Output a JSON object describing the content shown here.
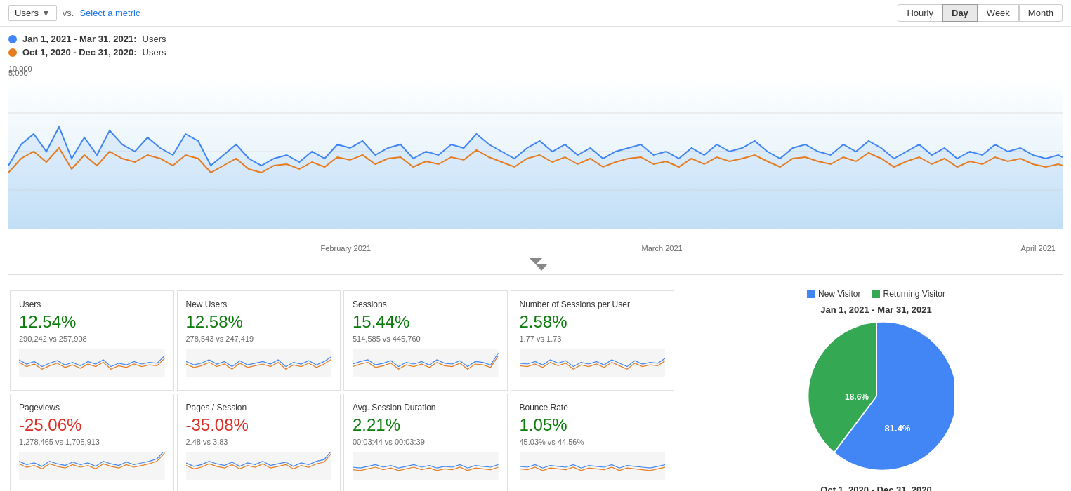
{
  "topbar": {
    "metric_selector": "Users",
    "vs_label": "vs.",
    "select_metric": "Select a metric",
    "time_buttons": [
      {
        "label": "Hourly",
        "active": false
      },
      {
        "label": "Day",
        "active": true
      },
      {
        "label": "Week",
        "active": false
      },
      {
        "label": "Month",
        "active": false
      }
    ]
  },
  "legend": {
    "range1_date": "Jan 1, 2021 - Mar 31, 2021:",
    "range1_metric": "Users",
    "range1_color": "#4285f4",
    "range2_date": "Oct 1, 2020 - Dec 31, 2020:",
    "range2_metric": "Users",
    "range2_color": "#e67c22"
  },
  "chart": {
    "y_labels": [
      "10,000",
      "5,000"
    ],
    "x_labels": [
      "February 2021",
      "March 2021",
      "April 2021"
    ]
  },
  "metrics": [
    {
      "title": "Users",
      "value": "12.54%",
      "type": "positive",
      "compare": "290,242 vs 257,908"
    },
    {
      "title": "New Users",
      "value": "12.58%",
      "type": "positive",
      "compare": "278,543 vs 247,419"
    },
    {
      "title": "Sessions",
      "value": "15.44%",
      "type": "positive",
      "compare": "514,585 vs 445,760"
    },
    {
      "title": "Number of Sessions per User",
      "value": "2.58%",
      "type": "positive",
      "compare": "1.77 vs 1.73"
    },
    {
      "title": "Pageviews",
      "value": "-25.06%",
      "type": "negative",
      "compare": "1,278,465 vs 1,705,913"
    },
    {
      "title": "Pages / Session",
      "value": "-35.08%",
      "type": "negative",
      "compare": "2.48 vs 3.83"
    },
    {
      "title": "Avg. Session Duration",
      "value": "2.21%",
      "type": "positive",
      "compare": "00:03:44 vs 00:03:39"
    },
    {
      "title": "Bounce Rate",
      "value": "1.05%",
      "type": "positive",
      "compare": "45.03% vs 44.56%"
    }
  ],
  "pie": {
    "legend": [
      {
        "label": "New Visitor",
        "color": "#4285f4"
      },
      {
        "label": "Returning Visitor",
        "color": "#34a853"
      }
    ],
    "period1_label": "Jan 1, 2021 - Mar 31, 2021",
    "period1_new_pct": 81.4,
    "period1_returning_pct": 18.6,
    "period1_new_label": "81.4%",
    "period1_returning_label": "18.6%",
    "period2_label": "Oct 1, 2020 - Dec 31, 2020"
  }
}
